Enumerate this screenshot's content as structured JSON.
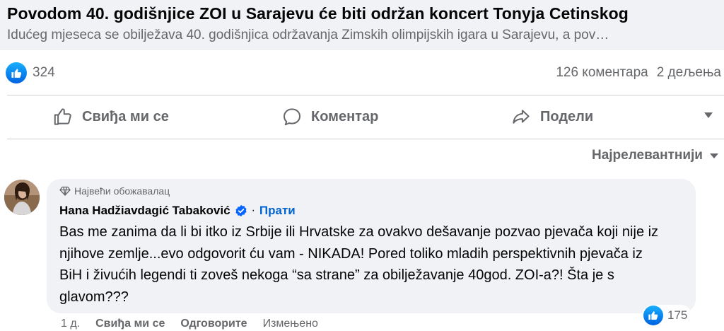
{
  "link_preview": {
    "title": "Povodom 40. godišnjice ZOI u Sarajevu će biti održan koncert Tonyja Cetinskog",
    "description": "Idućeg mjeseca se obilježava 40. godišnjica održavanja Zimskih olimpijskih igara u Sarajevu, a pov…"
  },
  "reactions": {
    "count": "324",
    "comments": "126 коментара",
    "shares": "2 дељења"
  },
  "actions": {
    "like": "Свиђа ми се",
    "comment": "Коментар",
    "share": "Подели"
  },
  "sort": {
    "label": "Најрелевантнији"
  },
  "comment": {
    "badge": "Највећи обожавалац",
    "author": "Hana Hadžiavdagić Tabaković",
    "separator": "·",
    "follow": "Прати",
    "text": "Bas me zanima da li bi itko iz Srbije ili Hrvatske za ovakvo dešavanje pozvao pjevača koji nije iz njihove zemlje...evo odgovorit ću vam - NIKADA! Pored toliko mladih perspektivnih pjevača iz BiH i živućih legendi ti zoveš nekoga “sa strane” za obilježavanje 40god. ZOI-a?! Šta je s glavom???",
    "reaction_count": "175",
    "time": "1 д.",
    "like": "Свиђа ми се",
    "reply": "Одговорите",
    "edited": "Измењено"
  },
  "colors": {
    "accent": "#0866ff",
    "secondary_text": "#65676b",
    "bubble_bg": "#f0f2f5",
    "link_text": "#0064d1"
  },
  "icons": [
    "like-icon",
    "comment-icon",
    "share-icon",
    "caret-down-icon",
    "diamond-icon",
    "verified-badge-icon"
  ]
}
